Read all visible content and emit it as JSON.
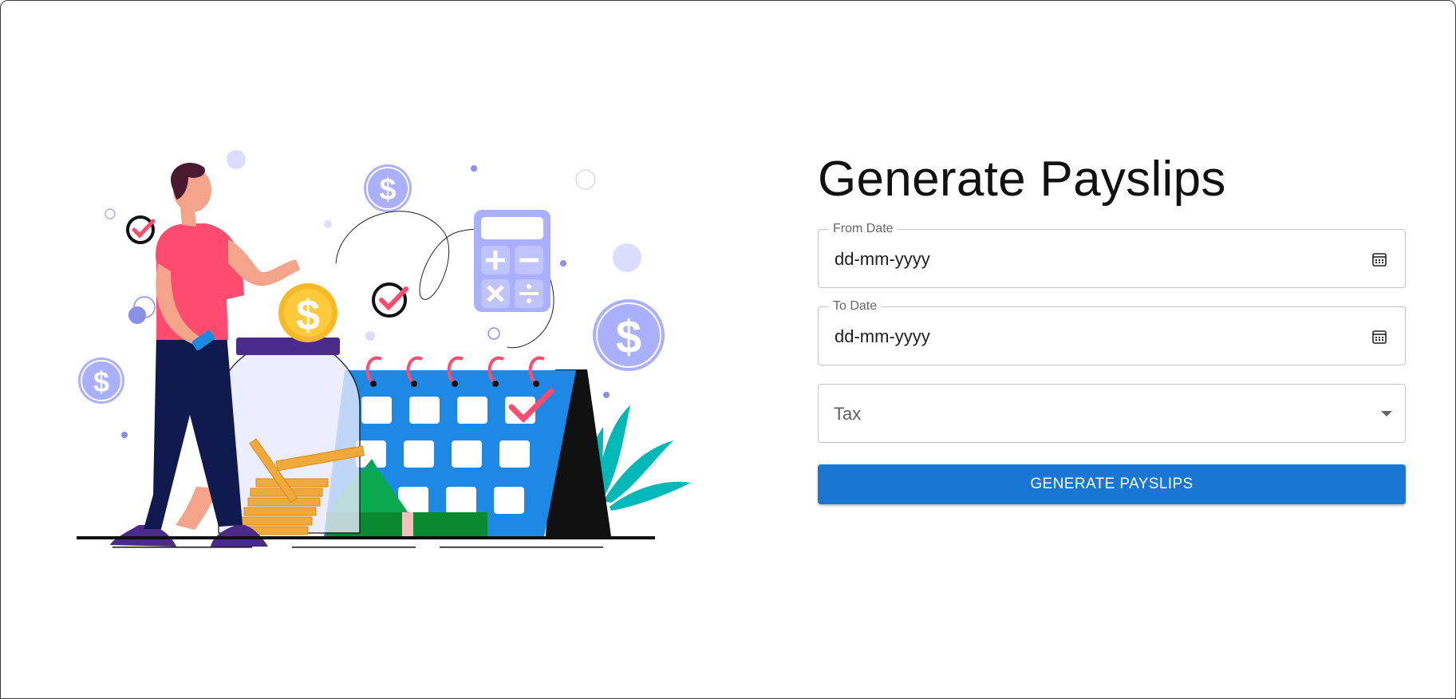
{
  "page": {
    "title": "Generate Payslips"
  },
  "form": {
    "from_date": {
      "label": "From Date",
      "value": "dd-mm-yyyy",
      "icon": "calendar-icon"
    },
    "to_date": {
      "label": "To Date",
      "value": "dd-mm-yyyy",
      "icon": "calendar-icon"
    },
    "tax_select": {
      "selected": "Tax",
      "icon": "chevron-down-icon"
    },
    "submit_label": "GENERATE PAYSLIPS"
  },
  "theme": {
    "primary": "#1976d2",
    "illustration_accent": "#ff4b6e",
    "illustration_blue": "#1e88e5",
    "illustration_lavender": "#aab0ff"
  },
  "illustration": {
    "icons": [
      "person-icon",
      "coin-jar-icon",
      "calendar-icon",
      "calculator-icon",
      "dollar-coin-icon",
      "checkmark-icon",
      "cash-icon",
      "plant-icon"
    ]
  }
}
